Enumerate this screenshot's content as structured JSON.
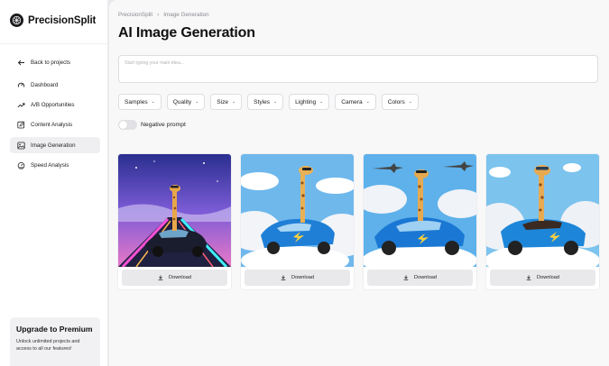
{
  "brand": {
    "name": "PrecisionSplit"
  },
  "nav": {
    "back": "Back to projects",
    "items": [
      {
        "label": "Dashboard",
        "icon": "dashboard-icon"
      },
      {
        "label": "A/B  Opportunities",
        "icon": "trend-icon"
      },
      {
        "label": "Content Analysis",
        "icon": "edit-icon"
      },
      {
        "label": "Image Generation",
        "icon": "image-icon",
        "active": true
      },
      {
        "label": "Speed Analysis",
        "icon": "speedometer-icon"
      }
    ]
  },
  "upgrade": {
    "title": "Upgrade to Premium",
    "text": "Unlock unlimited projects and access to all our features!"
  },
  "breadcrumb": {
    "root": "PrecisionSplit",
    "current": "Image Generation"
  },
  "page": {
    "title": "AI Image Generation"
  },
  "prompt": {
    "placeholder": "Start typing your main idea...",
    "value": ""
  },
  "filters": [
    "Samples",
    "Quality",
    "Size",
    "Styles",
    "Lighting",
    "Camera",
    "Colors"
  ],
  "negative_prompt": {
    "label": "Negative prompt",
    "enabled": false
  },
  "results": {
    "download_label": "Download",
    "images": [
      {
        "subject": "giraffe-driving-car-neon-road"
      },
      {
        "subject": "giraffe-driving-car-clouds"
      },
      {
        "subject": "giraffe-driving-car-planes"
      },
      {
        "subject": "giraffe-driving-convertible-clouds"
      }
    ]
  },
  "colors": {
    "accent": "#1b1b1f",
    "car_blue": "#1f7fd6",
    "sky": "#7ec1ee"
  }
}
